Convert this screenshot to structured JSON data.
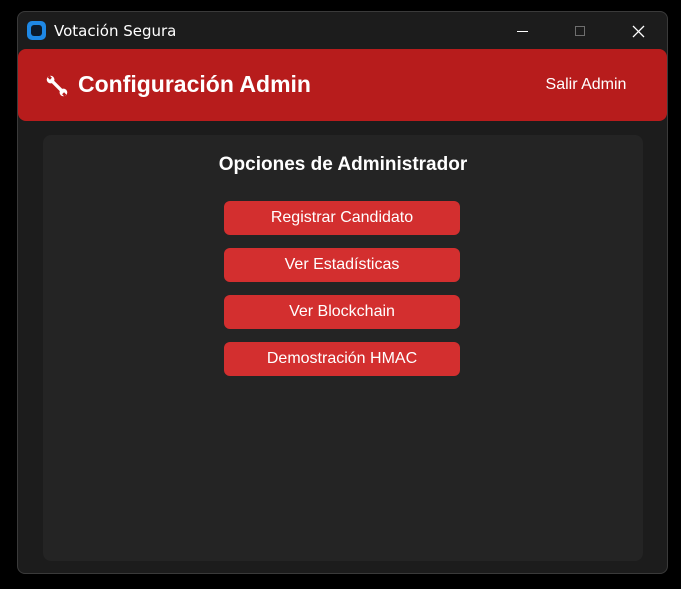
{
  "window": {
    "title": "Votación Segura",
    "icon": "app-icon",
    "controls": {
      "minimize_icon": "minimize-icon",
      "maximize_icon": "maximize-icon",
      "close_icon": "close-icon",
      "close_glyph": "✕"
    }
  },
  "header": {
    "icon": "wrench-icon",
    "title": "Configuración Admin",
    "logout_label": "Salir Admin",
    "background": "#b71c1c"
  },
  "panel": {
    "title": "Opciones de Administrador",
    "buttons": [
      {
        "label": "Registrar Candidato"
      },
      {
        "label": "Ver Estadísticas"
      },
      {
        "label": "Ver Blockchain"
      },
      {
        "label": "Demostración HMAC"
      }
    ],
    "button_color": "#d32f2f"
  }
}
